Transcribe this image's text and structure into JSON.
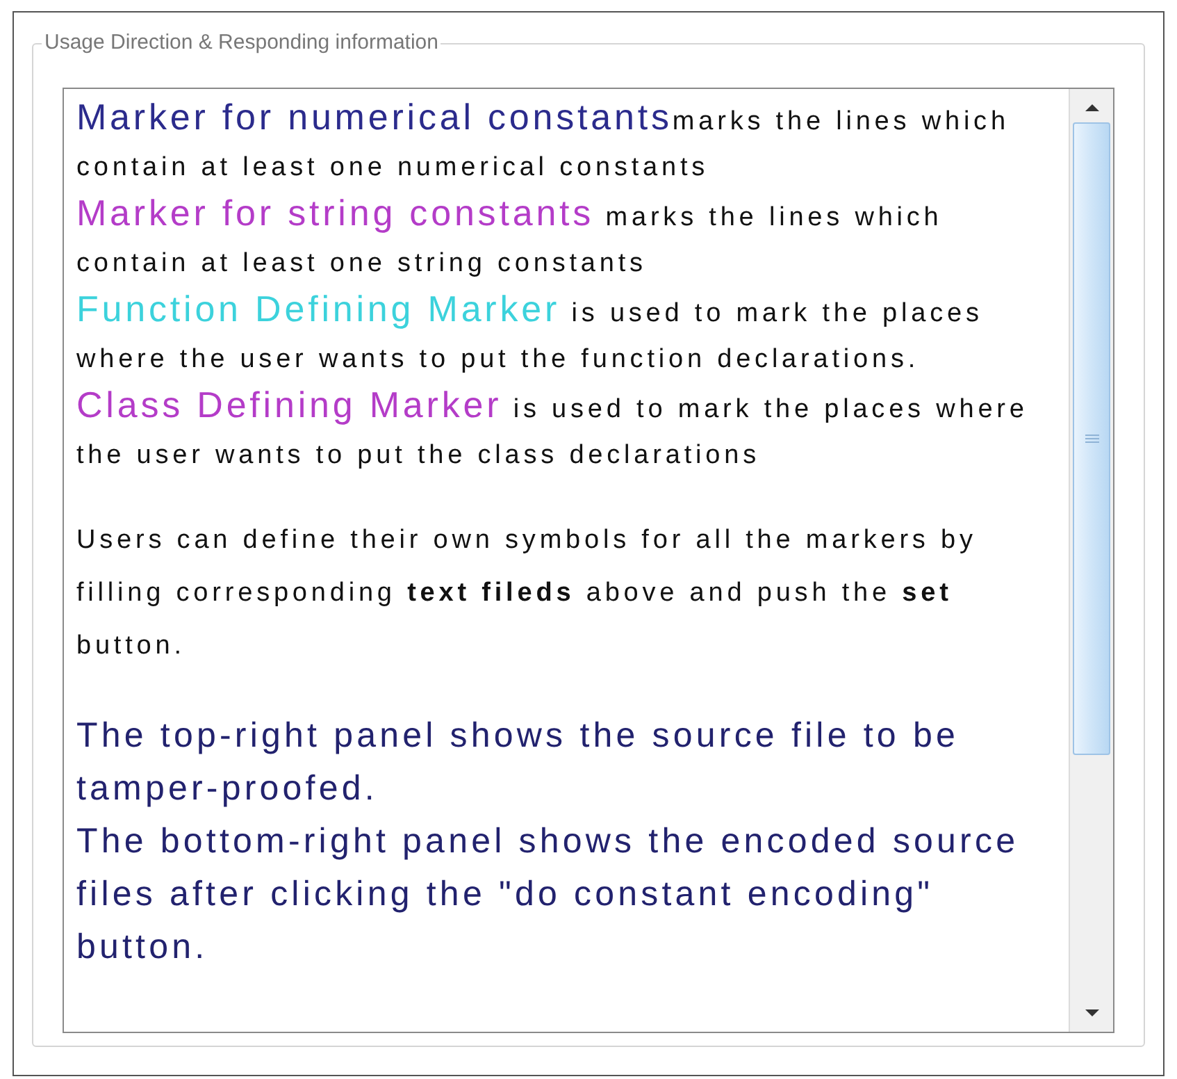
{
  "panel": {
    "legend": "Usage Direction & Responding information"
  },
  "markers": [
    {
      "term": "Marker for numerical constants",
      "color": "#2b2b8c",
      "description": "marks the lines which contain at least one numerical constants"
    },
    {
      "term": "Marker for string constants",
      "color": "#b43cc8",
      "description": " marks the lines which contain at least one string constants"
    },
    {
      "term": "Function Defining Marker",
      "color": "#3cd2dc",
      "description": " is used to mark the places where the user wants to put the function declarations."
    },
    {
      "term": "Class Defining Marker",
      "color": "#b43cc8",
      "description": " is used to mark the places where the user wants to put the class declarations"
    }
  ],
  "usage_note": "Users can define their own symbols for all the markers by filling corresponding **text fileds** above and push the **set** button.",
  "panel_notes": [
    "The top-right panel shows the source file to be tamper-proofed.",
    "The bottom-right panel shows the encoded source files after clicking the \"do constant encoding\" button."
  ]
}
